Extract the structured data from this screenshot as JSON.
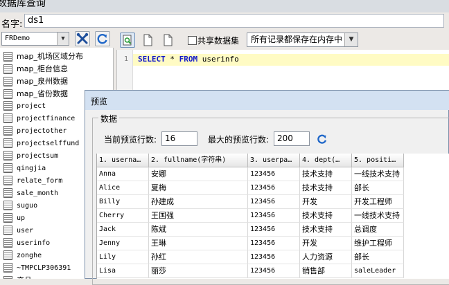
{
  "window": {
    "title": "数据库查询"
  },
  "name_field": {
    "label": "名字:",
    "value": "ds1"
  },
  "datasource": {
    "selected": "FRDemo"
  },
  "tables": [
    "map_机场区域分布",
    "map_柜台信息",
    "map_泉州数据",
    "map_省份数据",
    "project",
    "projectfinance",
    "projectother",
    "projectselffund",
    "projectsum",
    "qingjia",
    "relate_form",
    "sale_month",
    "suguo",
    "up",
    "user",
    "userinfo",
    "zonghe",
    "~TMPCLP306391",
    "产品"
  ],
  "sql_toolbar": {
    "share_label": "共享数据集",
    "memory_option": "所有记录都保存在内存中"
  },
  "editor": {
    "line_number": "1",
    "tokens": [
      {
        "text": "SELECT",
        "kind": "kw"
      },
      {
        "text": " * ",
        "kind": "plain"
      },
      {
        "text": "FROM",
        "kind": "kw"
      },
      {
        "text": " userinfo",
        "kind": "plain"
      }
    ]
  },
  "preview": {
    "title": "预览",
    "group_label": "数据",
    "current_rows_label": "当前预览行数:",
    "current_rows_value": "16",
    "max_rows_label": "最大的预览行数:",
    "max_rows_value": "200",
    "columns": [
      "1. userna…",
      "2. fullname(字符串)",
      "3. userpa…",
      "4. dept(…",
      "5. positi…"
    ],
    "rows": [
      [
        "Anna",
        "安娜",
        "123456",
        "技术支持",
        "一线技术支持"
      ],
      [
        "Alice",
        "夏梅",
        "123456",
        "技术支持",
        "部长"
      ],
      [
        "Billy",
        "孙建成",
        "123456",
        "开发",
        "开发工程师"
      ],
      [
        "Cherry",
        "王国强",
        "123456",
        "技术支持",
        "一线技术支持"
      ],
      [
        "Jack",
        "陈斌",
        "123456",
        "技术支持",
        "总调度"
      ],
      [
        "Jenny",
        "王琳",
        "123456",
        "开发",
        "维护工程师"
      ],
      [
        "Lily",
        "孙红",
        "123456",
        "人力资源",
        "部长"
      ],
      [
        "Lisa",
        "丽莎",
        "123456",
        "销售部",
        "saleLeader"
      ]
    ]
  },
  "colors": {
    "keyword": "#1219c8",
    "current_line": "#fffbc4",
    "dialog_title": "#d3e1f2"
  }
}
